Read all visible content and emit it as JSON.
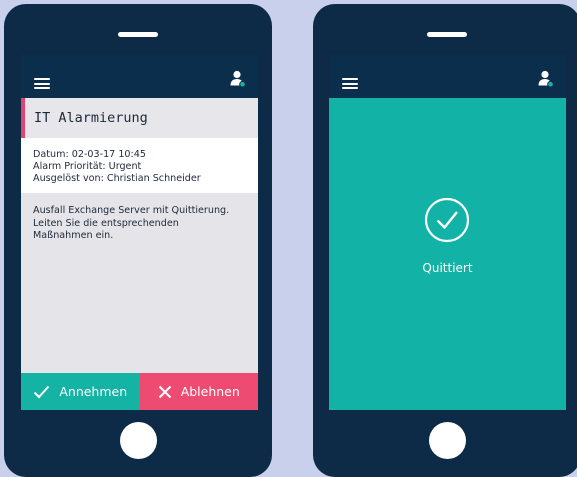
{
  "colors": {
    "background": "#c9d0ec",
    "phone_body": "#0d2a47",
    "app_bar": "#0b2e4d",
    "accent_red": "#ee4b73",
    "accent_teal": "#14b3a3",
    "user_badge": "#14b3a3"
  },
  "left_phone": {
    "alert_title": "IT Alarmierung",
    "meta": {
      "date": "Datum: 02-03-17  10:45",
      "priority": "Alarm Priorität: Urgent",
      "triggered_by": "Ausgelöst von: Christian Schneider"
    },
    "message": {
      "line1": "Ausfall Exchange Server mit Quittierung.",
      "line2": "Leiten Sie die entsprechenden",
      "line3": "Maßnahmen ein."
    },
    "buttons": {
      "accept_label": "Annehmen",
      "decline_label": "Ablehnen"
    }
  },
  "right_phone": {
    "confirm_label": "Quittiert"
  },
  "icons": [
    "menu-icon",
    "user-icon",
    "check-icon",
    "close-icon",
    "check-circle-icon"
  ]
}
